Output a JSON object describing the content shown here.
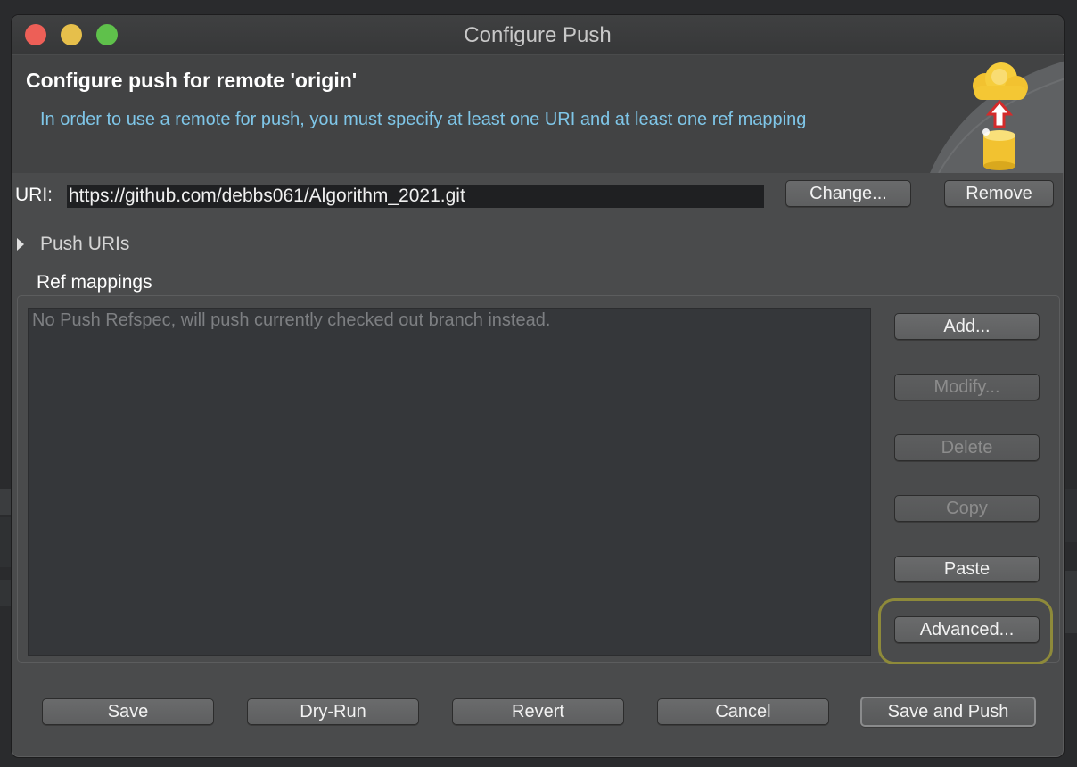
{
  "window": {
    "title": "Configure Push"
  },
  "header": {
    "heading": "Configure push for remote 'origin'",
    "description": "In order to use a remote for push, you must specify at least one URI and at least one ref mapping"
  },
  "uri": {
    "label": "URI:",
    "value": "https://github.com/debbs061/Algorithm_2021.git",
    "change_label": "Change...",
    "remove_label": "Remove"
  },
  "push_uris": {
    "label": "Push URIs"
  },
  "ref_mappings": {
    "label": "Ref mappings",
    "empty_text": "No Push Refspec, will push currently checked out branch instead.",
    "buttons": {
      "add": "Add...",
      "modify": "Modify...",
      "delete": "Delete",
      "copy": "Copy",
      "paste": "Paste",
      "advanced": "Advanced..."
    }
  },
  "footer": {
    "save": "Save",
    "dry_run": "Dry-Run",
    "revert": "Revert",
    "cancel": "Cancel",
    "save_and_push": "Save and Push"
  },
  "colors": {
    "description_text": "#7fc6e8",
    "highlight_ring": "#8e8a3a"
  }
}
